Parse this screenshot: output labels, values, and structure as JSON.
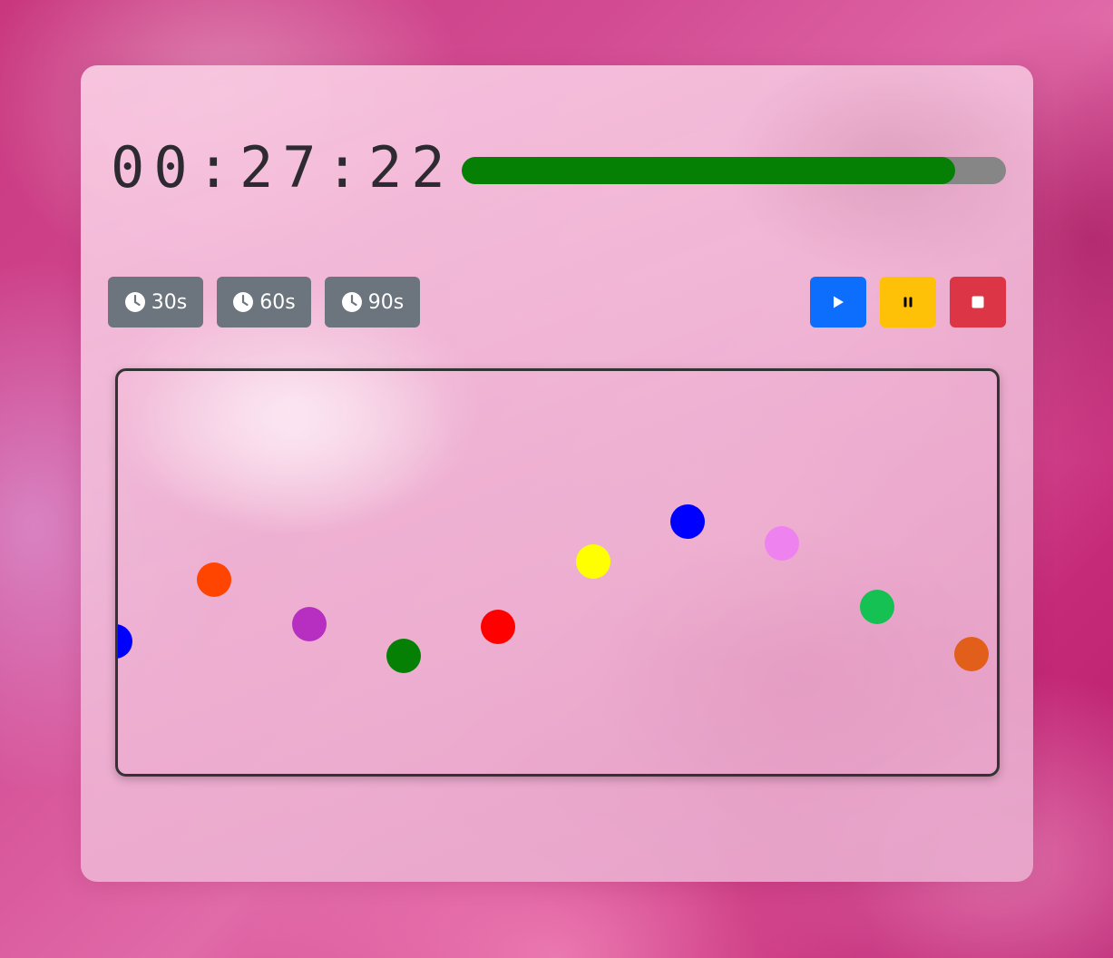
{
  "timer": {
    "display": "00:27:22",
    "progress": 0.906
  },
  "presets": [
    {
      "label": "30s",
      "icon": "clock-icon"
    },
    {
      "label": "60s",
      "icon": "clock-icon"
    },
    {
      "label": "90s",
      "icon": "clock-icon"
    }
  ],
  "controls": {
    "play": {
      "icon": "play-icon",
      "color": "#0d6efd"
    },
    "pause": {
      "icon": "pause-icon",
      "color": "#ffc107"
    },
    "stop": {
      "icon": "stop-icon",
      "color": "#dc3545"
    }
  },
  "colors": {
    "progress_fill": "#058005",
    "progress_track": "#868686",
    "preset_button": "#6c757d"
  },
  "balls": [
    {
      "color": "#0000ff"
    },
    {
      "color": "#ff4500"
    },
    {
      "color": "#b62fc0"
    },
    {
      "color": "#058005"
    },
    {
      "color": "#ff0000"
    },
    {
      "color": "#ffff00"
    },
    {
      "color": "#0000ff"
    },
    {
      "color": "#ee82ee"
    },
    {
      "color": "#16c154"
    },
    {
      "color": "#e15f1a"
    }
  ]
}
